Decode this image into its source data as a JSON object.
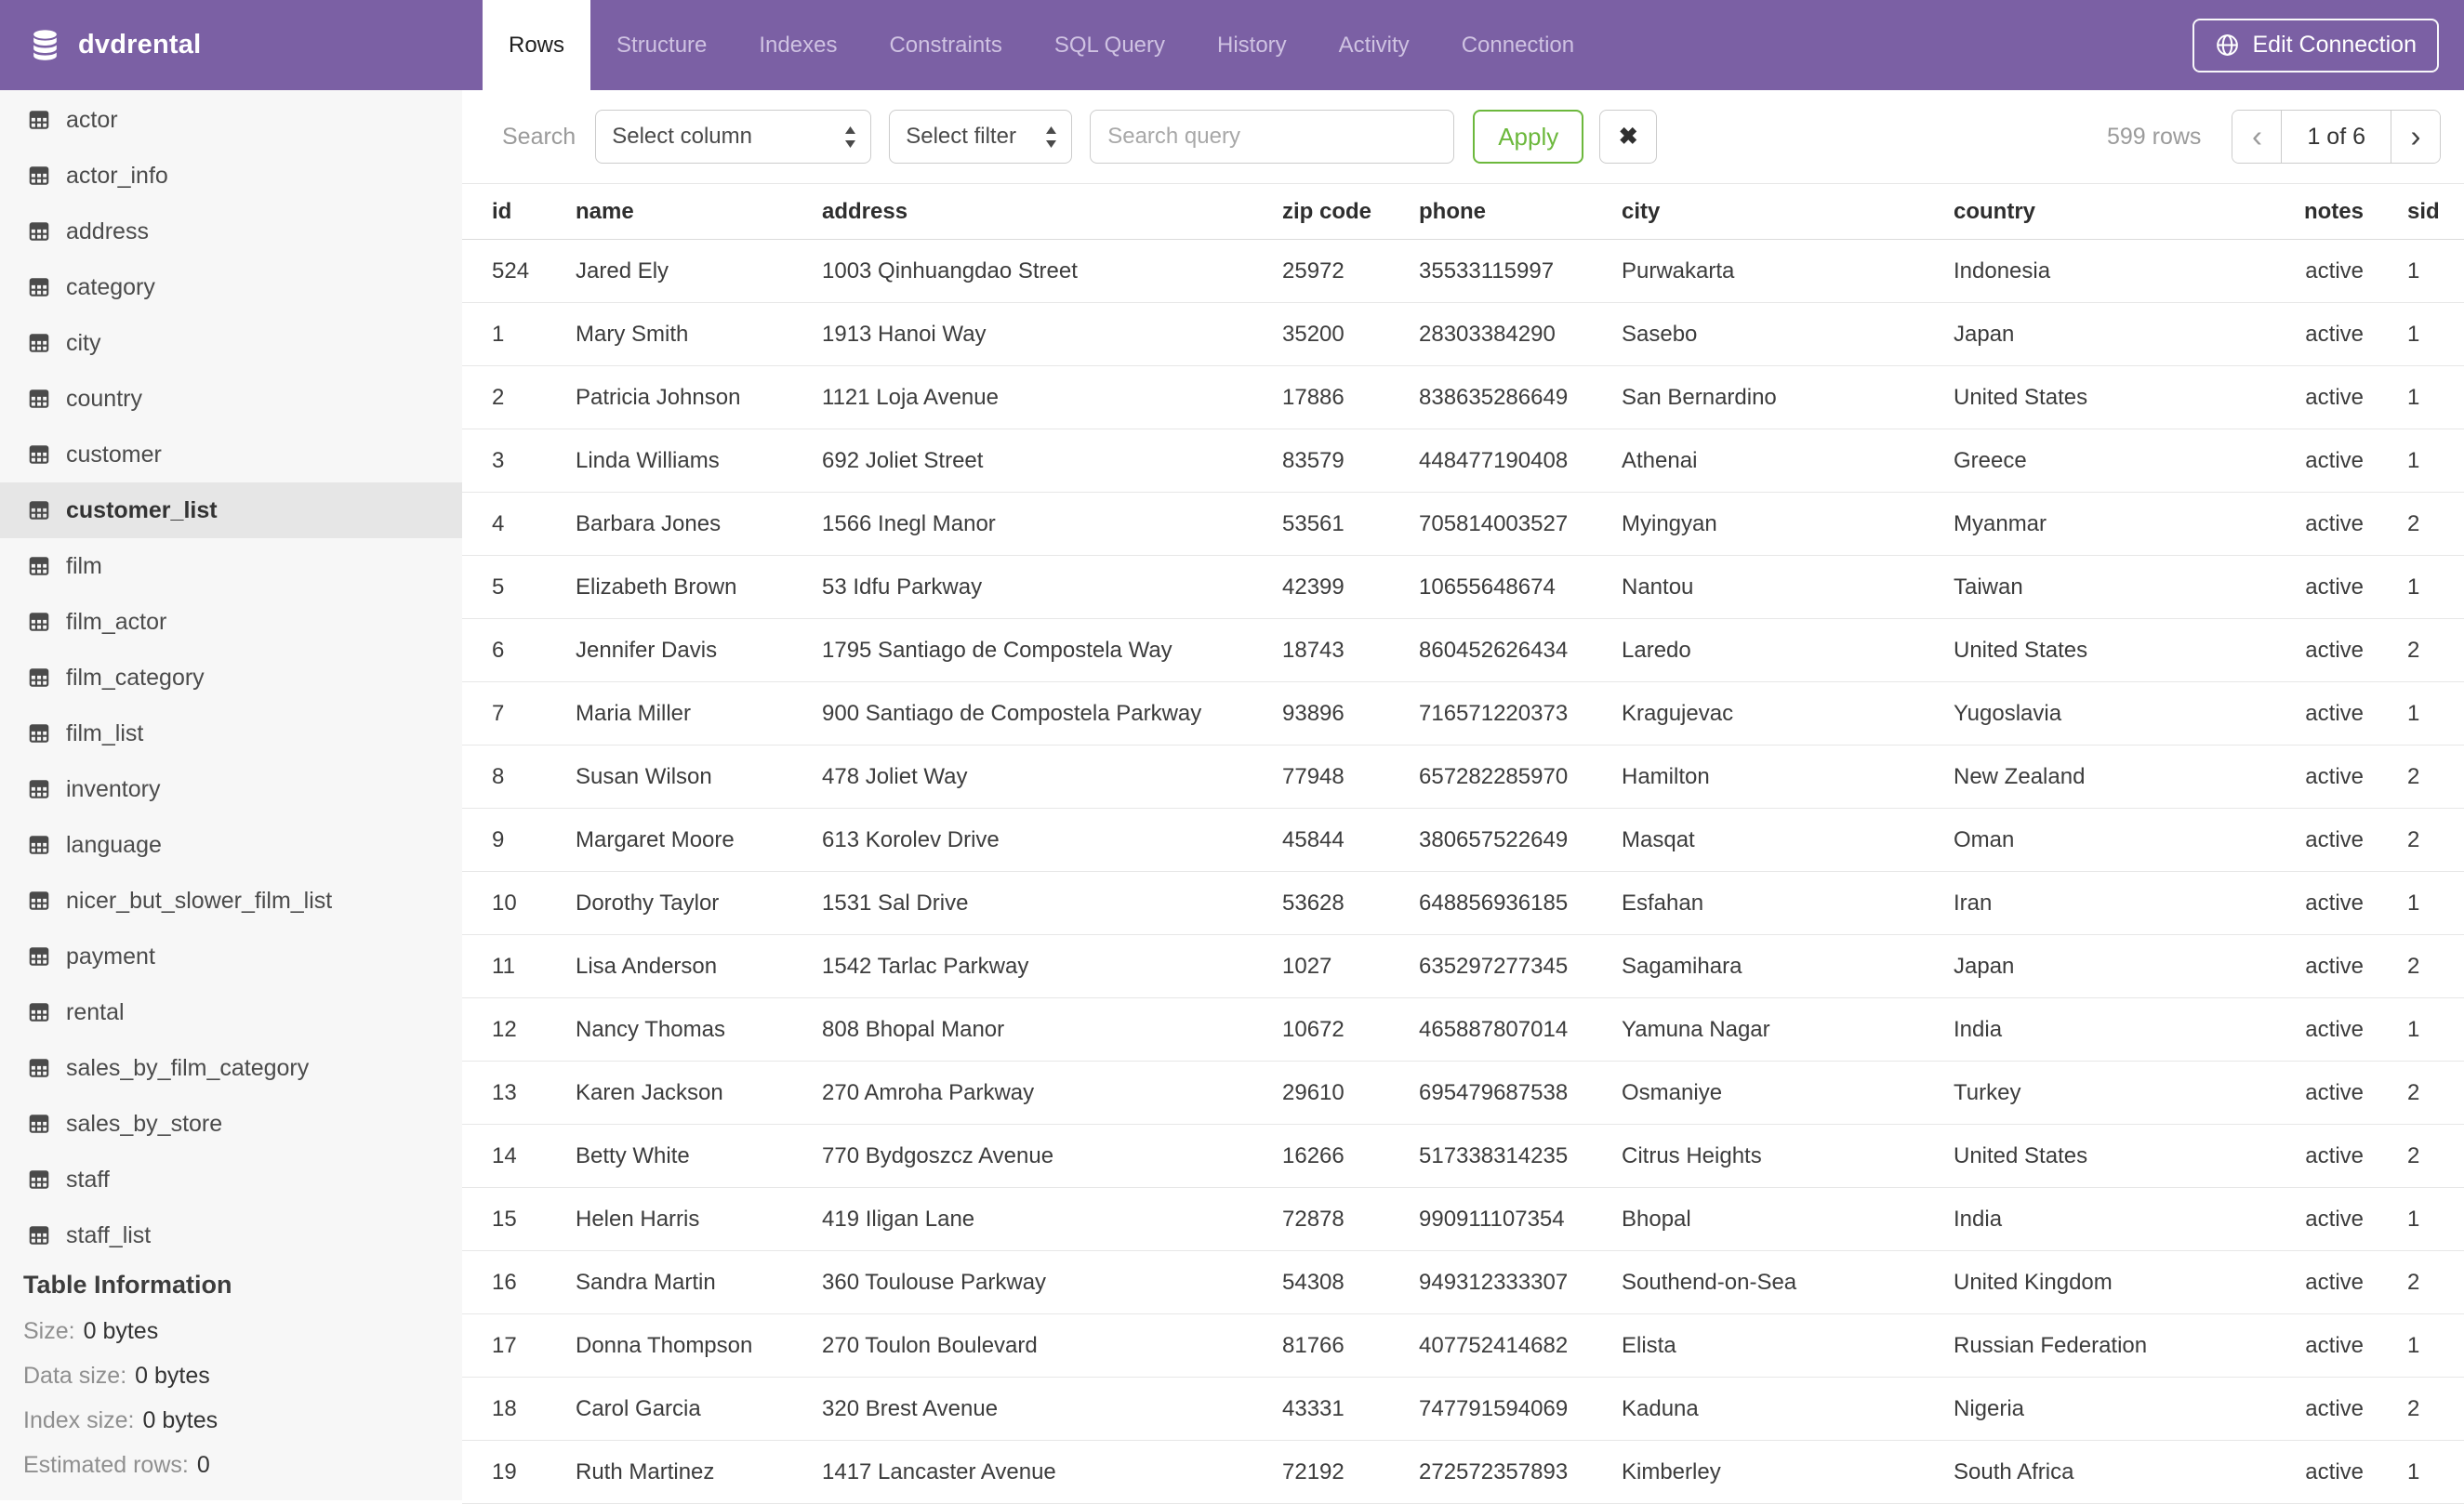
{
  "header": {
    "database_name": "dvdrental",
    "tabs": [
      {
        "label": "Rows",
        "active": true
      },
      {
        "label": "Structure",
        "active": false
      },
      {
        "label": "Indexes",
        "active": false
      },
      {
        "label": "Constraints",
        "active": false
      },
      {
        "label": "SQL Query",
        "active": false
      },
      {
        "label": "History",
        "active": false
      },
      {
        "label": "Activity",
        "active": false
      },
      {
        "label": "Connection",
        "active": false
      }
    ],
    "edit_connection_label": "Edit Connection"
  },
  "sidebar": {
    "tables": [
      "actor",
      "actor_info",
      "address",
      "category",
      "city",
      "country",
      "customer",
      "customer_list",
      "film",
      "film_actor",
      "film_category",
      "film_list",
      "inventory",
      "language",
      "nicer_but_slower_film_list",
      "payment",
      "rental",
      "sales_by_film_category",
      "sales_by_store",
      "staff",
      "staff_list"
    ],
    "selected_table": "customer_list",
    "table_information": {
      "title": "Table Information",
      "items": [
        {
          "label": "Size:",
          "value": "0 bytes"
        },
        {
          "label": "Data size:",
          "value": "0 bytes"
        },
        {
          "label": "Index size:",
          "value": "0 bytes"
        },
        {
          "label": "Estimated rows:",
          "value": "0"
        }
      ]
    }
  },
  "toolbar": {
    "search_label": "Search",
    "column_select_value": "Select column",
    "filter_select_value": "Select filter",
    "query_placeholder": "Search query",
    "query_value": "",
    "apply_label": "Apply",
    "clear_label": "✖",
    "row_count": "599 rows",
    "pagination": {
      "prev": "‹",
      "current": "1 of 6",
      "next": "›"
    }
  },
  "table": {
    "columns": [
      "id",
      "name",
      "address",
      "zip code",
      "phone",
      "city",
      "country",
      "notes",
      "sid"
    ],
    "rows": [
      [
        "524",
        "Jared Ely",
        "1003 Qinhuangdao Street",
        "25972",
        "35533115997",
        "Purwakarta",
        "Indonesia",
        "active",
        "1"
      ],
      [
        "1",
        "Mary Smith",
        "1913 Hanoi Way",
        "35200",
        "28303384290",
        "Sasebo",
        "Japan",
        "active",
        "1"
      ],
      [
        "2",
        "Patricia Johnson",
        "1121 Loja Avenue",
        "17886",
        "838635286649",
        "San Bernardino",
        "United States",
        "active",
        "1"
      ],
      [
        "3",
        "Linda Williams",
        "692 Joliet Street",
        "83579",
        "448477190408",
        "Athenai",
        "Greece",
        "active",
        "1"
      ],
      [
        "4",
        "Barbara Jones",
        "1566 Inegl Manor",
        "53561",
        "705814003527",
        "Myingyan",
        "Myanmar",
        "active",
        "2"
      ],
      [
        "5",
        "Elizabeth Brown",
        "53 Idfu Parkway",
        "42399",
        "10655648674",
        "Nantou",
        "Taiwan",
        "active",
        "1"
      ],
      [
        "6",
        "Jennifer Davis",
        "1795 Santiago de Compostela Way",
        "18743",
        "860452626434",
        "Laredo",
        "United States",
        "active",
        "2"
      ],
      [
        "7",
        "Maria Miller",
        "900 Santiago de Compostela Parkway",
        "93896",
        "716571220373",
        "Kragujevac",
        "Yugoslavia",
        "active",
        "1"
      ],
      [
        "8",
        "Susan Wilson",
        "478 Joliet Way",
        "77948",
        "657282285970",
        "Hamilton",
        "New Zealand",
        "active",
        "2"
      ],
      [
        "9",
        "Margaret Moore",
        "613 Korolev Drive",
        "45844",
        "380657522649",
        "Masqat",
        "Oman",
        "active",
        "2"
      ],
      [
        "10",
        "Dorothy Taylor",
        "1531 Sal Drive",
        "53628",
        "648856936185",
        "Esfahan",
        "Iran",
        "active",
        "1"
      ],
      [
        "11",
        "Lisa Anderson",
        "1542 Tarlac Parkway",
        "1027",
        "635297277345",
        "Sagamihara",
        "Japan",
        "active",
        "2"
      ],
      [
        "12",
        "Nancy Thomas",
        "808 Bhopal Manor",
        "10672",
        "465887807014",
        "Yamuna Nagar",
        "India",
        "active",
        "1"
      ],
      [
        "13",
        "Karen Jackson",
        "270 Amroha Parkway",
        "29610",
        "695479687538",
        "Osmaniye",
        "Turkey",
        "active",
        "2"
      ],
      [
        "14",
        "Betty White",
        "770 Bydgoszcz Avenue",
        "16266",
        "517338314235",
        "Citrus Heights",
        "United States",
        "active",
        "2"
      ],
      [
        "15",
        "Helen Harris",
        "419 Iligan Lane",
        "72878",
        "990911107354",
        "Bhopal",
        "India",
        "active",
        "1"
      ],
      [
        "16",
        "Sandra Martin",
        "360 Toulouse Parkway",
        "54308",
        "949312333307",
        "Southend-on-Sea",
        "United Kingdom",
        "active",
        "2"
      ],
      [
        "17",
        "Donna Thompson",
        "270 Toulon Boulevard",
        "81766",
        "407752414682",
        "Elista",
        "Russian Federation",
        "active",
        "1"
      ],
      [
        "18",
        "Carol Garcia",
        "320 Brest Avenue",
        "43331",
        "747791594069",
        "Kaduna",
        "Nigeria",
        "active",
        "2"
      ],
      [
        "19",
        "Ruth Martinez",
        "1417 Lancaster Avenue",
        "72192",
        "272572357893",
        "Kimberley",
        "South Africa",
        "active",
        "1"
      ]
    ]
  },
  "colors": {
    "header-purple": "#7B60A4",
    "tab-text": "#CFC2E2",
    "accent-green": "#6CB83C",
    "sidebar-bg": "#F7F7F7",
    "selected-bg": "#E6E6E6",
    "control-border": "#CCCCCC",
    "row-border": "#E7E7E7",
    "muted-text": "#9B9B9B",
    "body-text": "#3C3C3C"
  }
}
